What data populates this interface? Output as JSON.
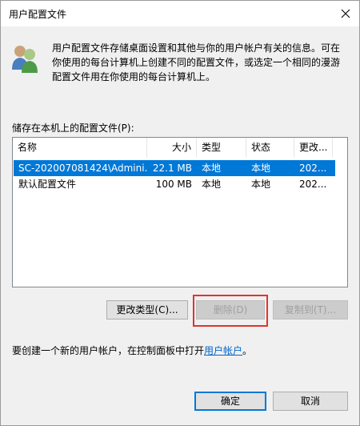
{
  "window": {
    "title": "用户配置文件"
  },
  "description": {
    "line1": "用户配置文件存储桌面设置和其他与你的用户帐户有关的信息。可在",
    "line2": "你使用的每台计算机上创建不同的配置文件，或选定一个相同的漫游",
    "line3": "配置文件用在你使用的每台计算机上。"
  },
  "profiles": {
    "label": "储存在本机上的配置文件(P):",
    "columns": [
      "名称",
      "大小",
      "类型",
      "状态",
      "更改..."
    ],
    "rows": [
      {
        "name": "SC-202007081424\\Admini...",
        "size": "22.1 MB",
        "type": "本地",
        "status": "本地",
        "modified": "202...",
        "selected": true
      },
      {
        "name": "默认配置文件",
        "size": "100 MB",
        "type": "本地",
        "status": "本地",
        "modified": "202...",
        "selected": false
      }
    ]
  },
  "buttons": {
    "change_type": "更改类型(C)...",
    "delete": "删除(D)",
    "copy_to": "复制到(T)...",
    "ok": "确定",
    "cancel": "取消"
  },
  "footer": {
    "text_before": "要创建一个新的用户帐户，在控制面板中打开",
    "link": "用户帐户",
    "text_after": "。"
  },
  "colors": {
    "selection": "#0078d7",
    "highlight_outline": "#e03333",
    "link": "#0066cc"
  }
}
